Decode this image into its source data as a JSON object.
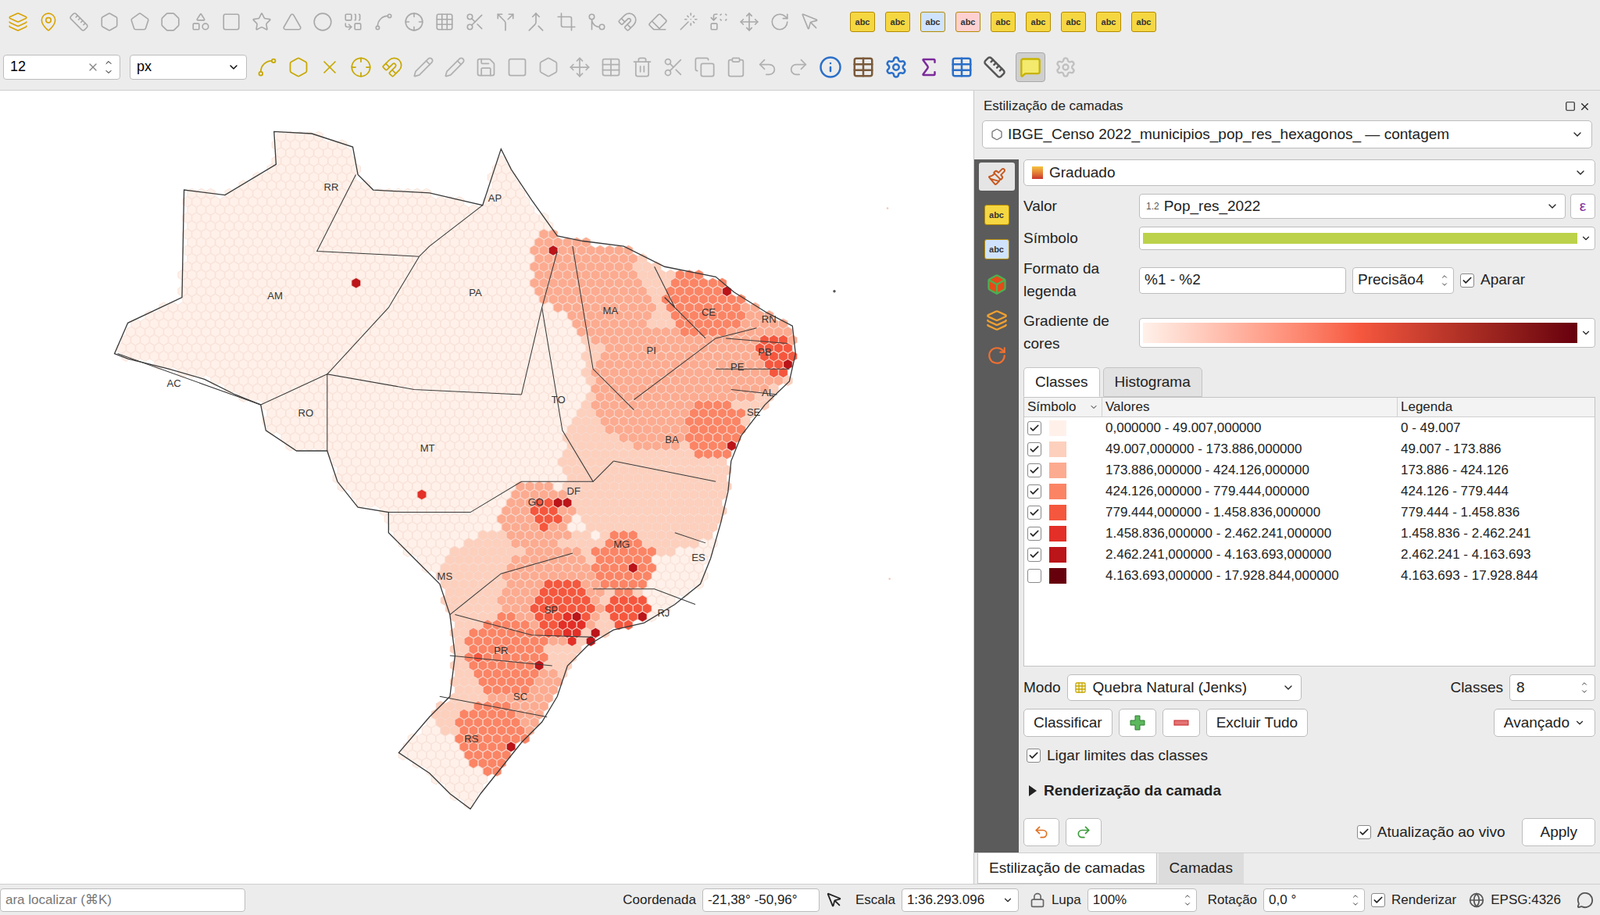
{
  "toolbar": {
    "size_value": "12",
    "unit": "px",
    "label_icon_text": "abc",
    "map_tips_on": true
  },
  "map": {
    "states": [
      "RR",
      "AP",
      "AM",
      "PA",
      "MA",
      "CE",
      "RN",
      "PB",
      "PE",
      "AL",
      "SE",
      "PI",
      "TO",
      "BA",
      "AC",
      "RO",
      "MT",
      "GO",
      "DF",
      "MG",
      "ES",
      "MS",
      "SP",
      "RJ",
      "PR",
      "SC",
      "RS"
    ]
  },
  "panel": {
    "title": "Estilização de camadas",
    "layer": "IBGE_Censo 2022_municipios_pop_res_hexagonos_ — contagem",
    "renderer": "Graduado",
    "value_label": "Valor",
    "value_type": "1.2",
    "value": "Pop_res_2022",
    "expression_button": "ε",
    "symbol_label": "Símbolo",
    "legend_format_label": "Formato da legenda",
    "legend_format": "%1 - %2",
    "precision_label": "Precisão",
    "precision": "4",
    "trim_label": "Aparar",
    "trim_checked": true,
    "ramp_label": "Gradiente de cores",
    "tabs": [
      {
        "label": "Classes",
        "selected": true
      },
      {
        "label": "Histograma",
        "selected": false
      }
    ],
    "columns": [
      "Símbolo",
      "Valores",
      "Legenda"
    ],
    "classes": [
      {
        "values": "0,000000 - 49.007,000000",
        "legend": "0 - 49.007",
        "checked": true,
        "color": "#fff1ea"
      },
      {
        "values": "49.007,000000 - 173.886,000000",
        "legend": "49.007 - 173.886",
        "checked": true,
        "color": "#fdd0bd"
      },
      {
        "values": "173.886,000000 - 424.126,000000",
        "legend": "173.886 - 424.126",
        "checked": true,
        "color": "#fcab90"
      },
      {
        "values": "424.126,000000 - 779.444,000000",
        "legend": "424.126 - 779.444",
        "checked": true,
        "color": "#fb8465"
      },
      {
        "values": "779.444,000000 - 1.458.836,000000",
        "legend": "779.444 - 1.458.836",
        "checked": true,
        "color": "#f5573e"
      },
      {
        "values": "1.458.836,000000 - 2.462.241,000000",
        "legend": "1.458.836 - 2.462.241",
        "checked": true,
        "color": "#e32f27"
      },
      {
        "values": "2.462.241,000000 - 4.163.693,000000",
        "legend": "2.462.241 - 4.163.693",
        "checked": true,
        "color": "#bb1419"
      },
      {
        "values": "4.163.693,000000 - 17.928.844,000000",
        "legend": "4.163.693 - 17.928.844",
        "checked": false,
        "color": "#67000d"
      }
    ],
    "mode_label": "Modo",
    "mode": "Quebra Natural (Jenks)",
    "classes_label": "Classes",
    "classes_count": "8",
    "classify_button": "Classificar",
    "delete_all_button": "Excluir Tudo",
    "advanced_button": "Avançado",
    "link_bounds_label": "Ligar limites das classes",
    "link_bounds_checked": true,
    "rendering_section": "Renderização da camada",
    "rendering_expanded": false,
    "live_update_label": "Atualização ao vivo",
    "live_update_checked": true,
    "apply_button": "Apply",
    "bottom_tabs": [
      {
        "label": "Estilização de camadas",
        "selected": true
      },
      {
        "label": "Camadas",
        "selected": false
      }
    ]
  },
  "status_bar": {
    "locator_placeholder": "ara localizar (⌘K)",
    "coordinate_label": "Coordenada",
    "coordinate": "-21,38° -50,96°",
    "scale_label": "Escala",
    "scale": "1:36.293.096",
    "magnifier_label": "Lupa",
    "magnifier": "100%",
    "rotation_label": "Rotação",
    "rotation": "0,0 °",
    "render_label": "Renderizar",
    "render_checked": true,
    "crs": "EPSG:4326"
  }
}
